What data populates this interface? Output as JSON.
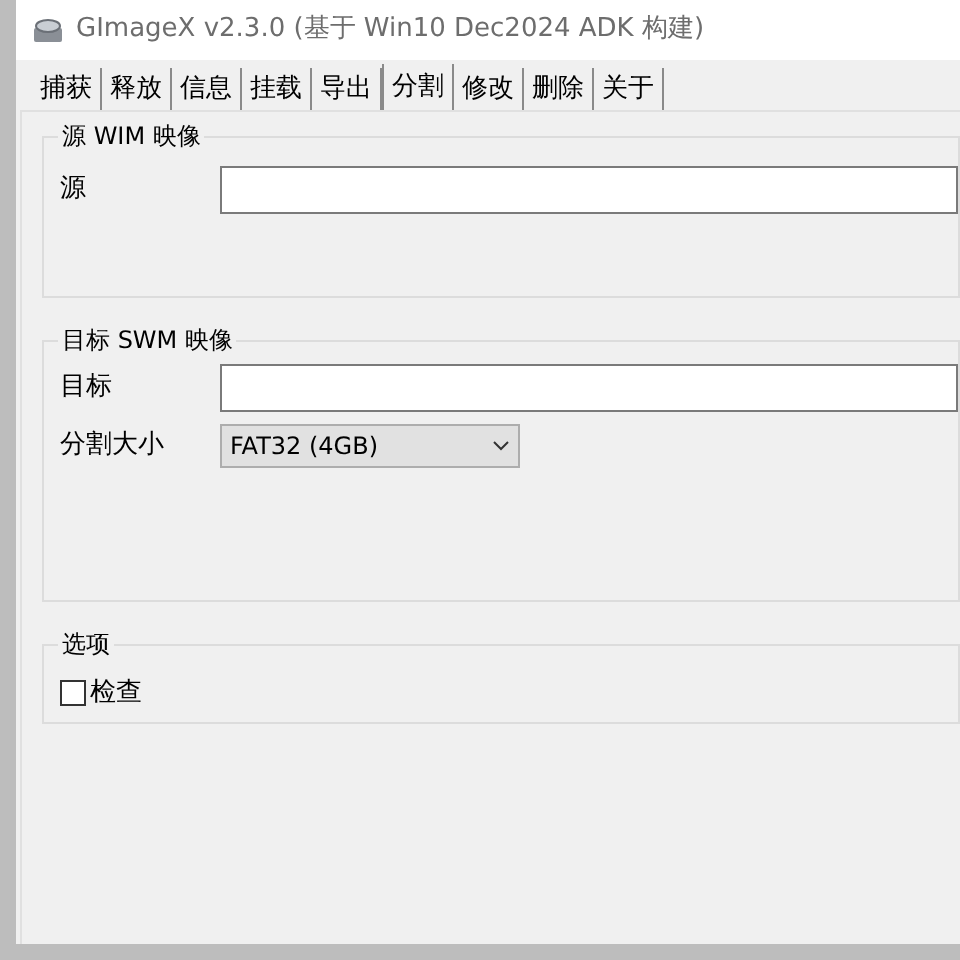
{
  "window": {
    "title": "GImageX v2.3.0 (基于 Win10 Dec2024 ADK 构建)"
  },
  "tabs": [
    {
      "label": "捕获",
      "selected": false
    },
    {
      "label": "释放",
      "selected": false
    },
    {
      "label": "信息",
      "selected": false
    },
    {
      "label": "挂载",
      "selected": false
    },
    {
      "label": "导出",
      "selected": false
    },
    {
      "label": "分割",
      "selected": true
    },
    {
      "label": "修改",
      "selected": false
    },
    {
      "label": "删除",
      "selected": false
    },
    {
      "label": "关于",
      "selected": false
    }
  ],
  "source_group": {
    "title": "源 WIM 映像",
    "source_label": "源"
  },
  "target_group": {
    "title": "目标 SWM 映像",
    "target_label": "目标",
    "split_size_label": "分割大小",
    "split_size_value": "FAT32 (4GB)"
  },
  "options_group": {
    "title": "选项",
    "check": {
      "label": "检查",
      "checked": false
    }
  }
}
